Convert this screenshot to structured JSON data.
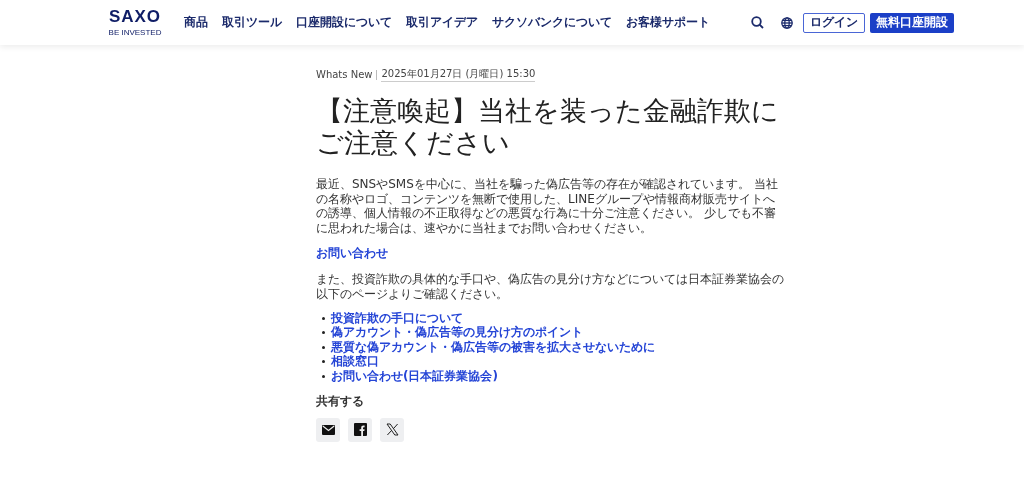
{
  "header": {
    "logo": {
      "name": "SAXO",
      "tagline": "BE INVESTED"
    },
    "nav": [
      "商品",
      "取引ツール",
      "口座開設について",
      "取引アイデア",
      "サクソバンクについて",
      "お客様サポート"
    ],
    "login": "ログイン",
    "signup": "無料口座開設"
  },
  "article": {
    "category": "Whats New",
    "date": "2025年01月27日 (月曜日) 15:30",
    "title": "【注意喚起】当社を装った金融詐欺にご注意ください",
    "blocks": [
      {
        "kind": "text",
        "text": "最近、SNSやSMSを中心に、当社を騙った偽広告等の存在が確認されています。 当社の名称やロゴ、コンテンツを無断で使用した、LINEグループや情報商材販売サイトへの誘導、個人情報の不正取得などの悪質な行為に十分ご注意ください。 少しでも不審に思われた場合は、速やかに当社までお問い合わせください。"
      },
      {
        "kind": "link",
        "text": "お問い合わせ"
      },
      {
        "kind": "text",
        "text": "また、投資詐欺の具体的な手口や、偽広告の見分け方などについては日本証券業協会の以下のページよりご確認ください。"
      },
      {
        "kind": "links",
        "items": [
          "投資詐欺の手口について",
          "偽アカウント・偽広告等の見分け方のポイント",
          "悪質な偽アカウント・偽広告等の被害を拡大させないために",
          "相談窓口",
          "お問い合わせ(日本証券業協会)"
        ]
      }
    ],
    "share": {
      "label": "共有する",
      "buttons": [
        {
          "kind": "mail"
        },
        {
          "kind": "facebook"
        },
        {
          "kind": "x"
        }
      ]
    }
  }
}
